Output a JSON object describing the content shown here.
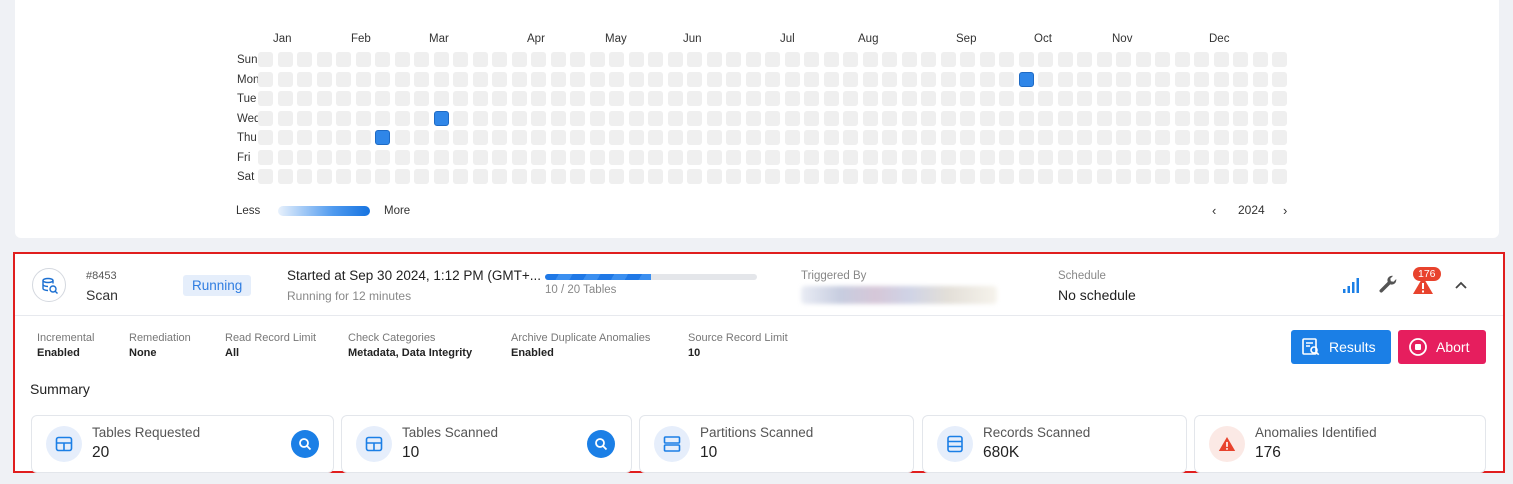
{
  "heatmap": {
    "months": [
      "Jan",
      "Feb",
      "Mar",
      "Apr",
      "May",
      "Jun",
      "Jul",
      "Aug",
      "Sep",
      "Oct",
      "Nov",
      "Dec"
    ],
    "days": [
      "Sun",
      "Mon",
      "Tue",
      "Wed",
      "Thu",
      "Fri",
      "Sat"
    ],
    "legend_less": "Less",
    "legend_more": "More",
    "year": "2024",
    "active_color": "#2f86e8",
    "empty_color": "#efefef"
  },
  "operation": {
    "id": "#8453",
    "type": "Scan",
    "status": "Running",
    "started": "Started at Sep 30 2024, 1:12 PM (GMT+...",
    "running_for": "Running for 12 minutes",
    "progress": {
      "done": 10,
      "total": 20,
      "text": "10 / 20 Tables"
    },
    "triggered_by_label": "Triggered By",
    "schedule_label": "Schedule",
    "schedule_value": "No schedule",
    "anomaly_count": "176"
  },
  "details": [
    {
      "label": "Incremental",
      "value": "Enabled"
    },
    {
      "label": "Remediation",
      "value": "None"
    },
    {
      "label": "Read Record Limit",
      "value": "All"
    },
    {
      "label": "Check Categories",
      "value": "Metadata, Data Integrity"
    },
    {
      "label": "Archive Duplicate Anomalies",
      "value": "Enabled"
    },
    {
      "label": "Source Record Limit",
      "value": "10"
    }
  ],
  "buttons": {
    "results": "Results",
    "abort": "Abort"
  },
  "summary": {
    "title": "Summary",
    "tiles": [
      {
        "label": "Tables Requested",
        "value": "20"
      },
      {
        "label": "Tables Scanned",
        "value": "10"
      },
      {
        "label": "Partitions Scanned",
        "value": "10"
      },
      {
        "label": "Records Scanned",
        "value": "680K"
      },
      {
        "label": "Anomalies Identified",
        "value": "176"
      }
    ]
  },
  "colors": {
    "primary": "#1b7fe6",
    "abort": "#e61e5e",
    "warning": "#e8432d",
    "highlight_border": "#e01e1e"
  }
}
